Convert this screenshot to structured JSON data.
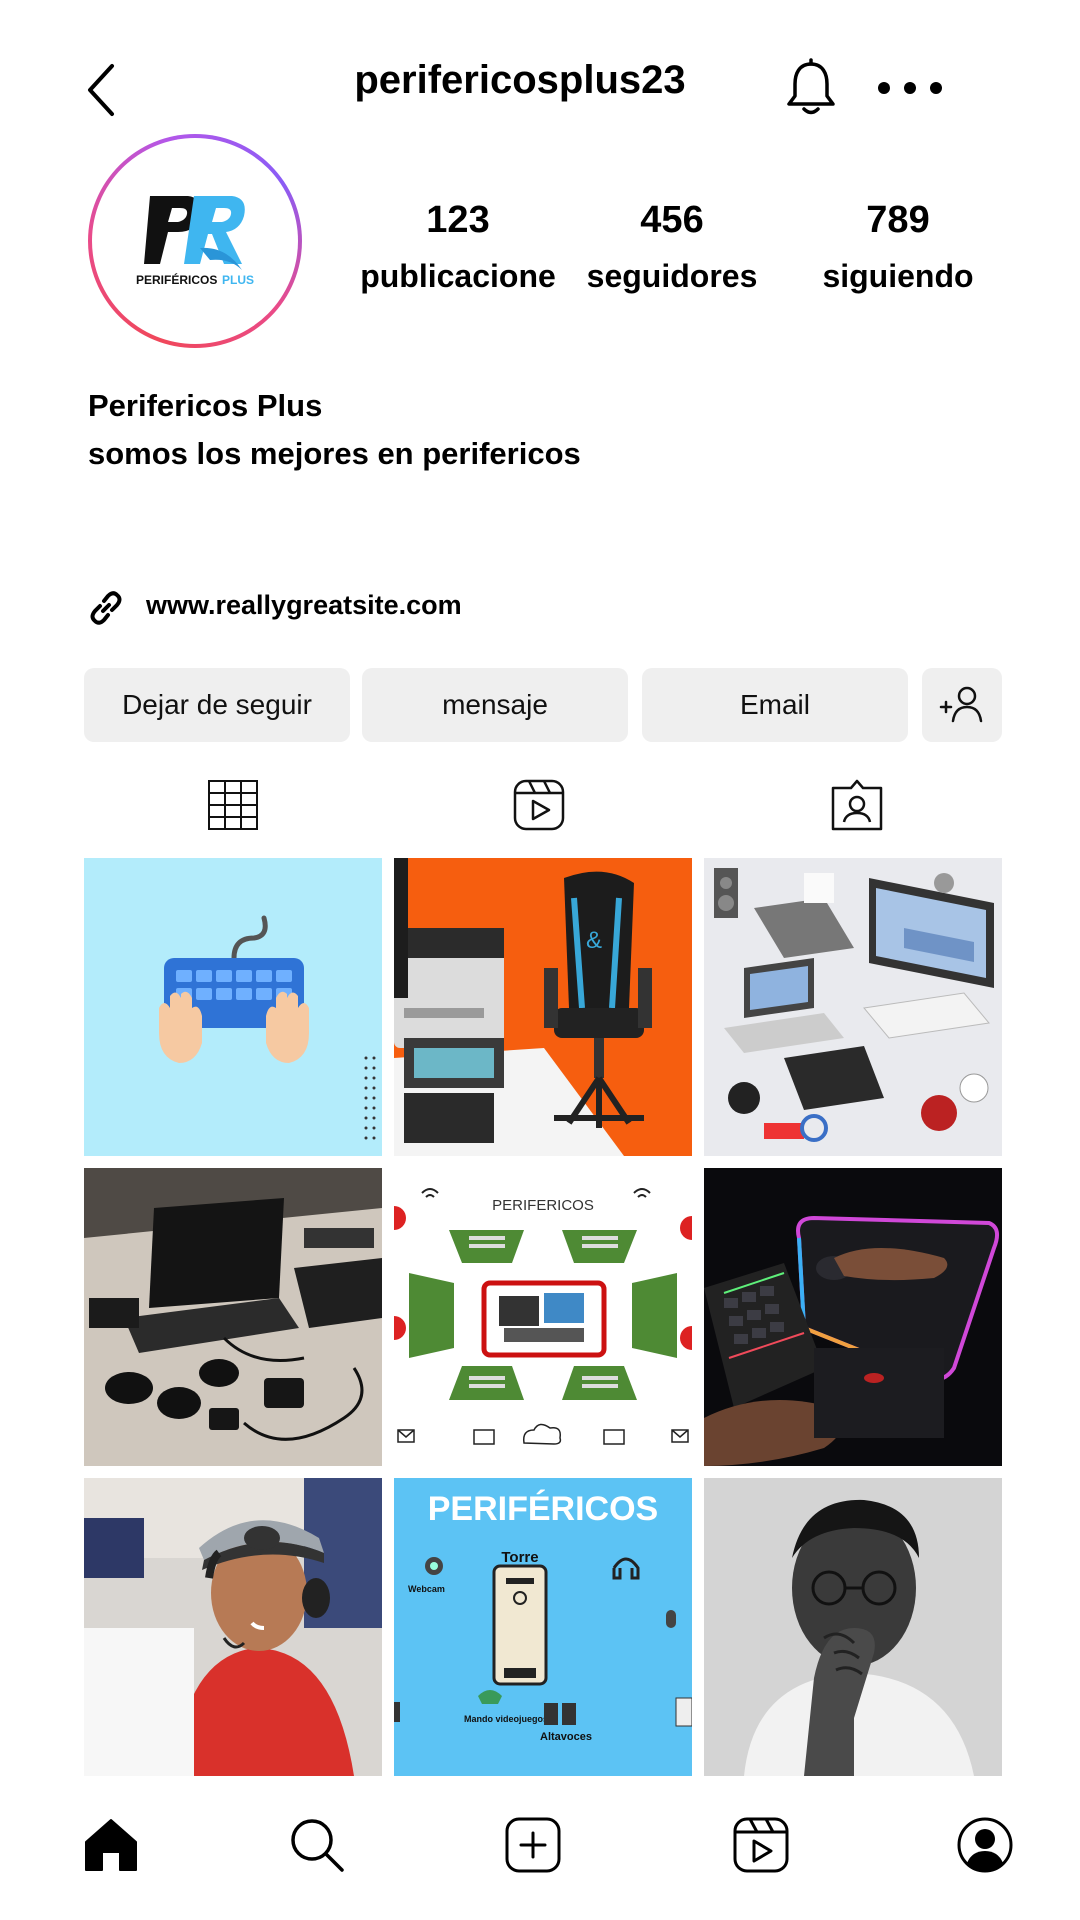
{
  "header": {
    "username": "perifericosplus23",
    "icons": [
      "back-icon",
      "bell-icon",
      "more-icon"
    ]
  },
  "profile": {
    "avatar_logo": {
      "letters": "PR",
      "caption": "PERIFÉRICOS PLUS"
    },
    "stats": [
      {
        "value": "123",
        "label": "publicacione"
      },
      {
        "value": "456",
        "label": "seguidores"
      },
      {
        "value": "789",
        "label": "siguiendo"
      }
    ],
    "name": "Perifericos Plus",
    "bio": "somos los mejores en perifericos",
    "website": "www.reallygreatsite.com"
  },
  "actions": {
    "unfollow": "Dejar de seguir",
    "message": "mensaje",
    "email": "Email"
  },
  "tabs": [
    "grid-icon",
    "reels-icon",
    "tagged-icon"
  ],
  "posts": [
    {
      "id": "keyboard-illustration"
    },
    {
      "id": "printer-and-gaming-chair"
    },
    {
      "id": "isometric-peripherals"
    },
    {
      "id": "laptop-and-accessories"
    },
    {
      "id": "perifericos-diagram",
      "title": "PERIFERICOS"
    },
    {
      "id": "rgb-keyboard-mousepad"
    },
    {
      "id": "gamer-with-headset"
    },
    {
      "id": "perifericos-poster",
      "title": "PERIFÉRICOS",
      "labels": [
        "Torre",
        "Webcam",
        "Mando videojuegos",
        "Altavoces"
      ]
    },
    {
      "id": "thinking-man-bw"
    }
  ],
  "bottom_nav": [
    "home-icon",
    "search-icon",
    "create-icon",
    "reels-nav-icon",
    "profile-icon"
  ],
  "colors": {
    "button_bg": "#efefef",
    "ring_start": "#f0475a",
    "ring_end": "#8a5cf6",
    "accent_blue": "#3fb6f0"
  }
}
